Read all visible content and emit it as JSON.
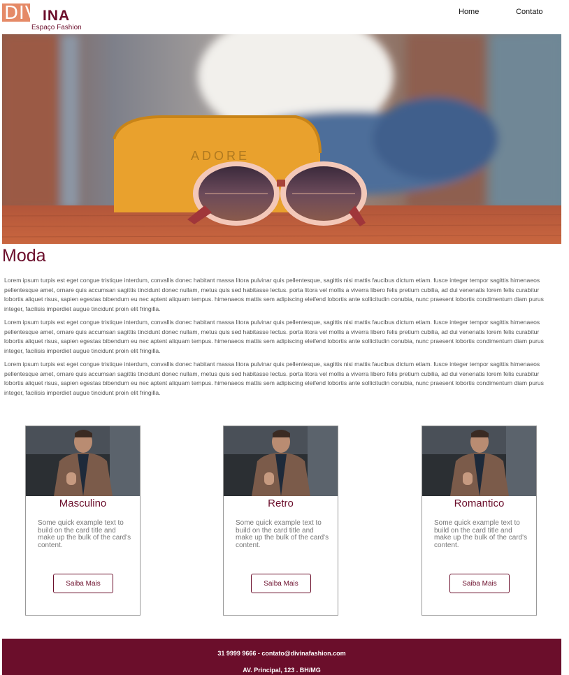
{
  "brand": {
    "logo_primary": "DIV",
    "logo_secondary": "INA",
    "tagline": "Espaço Fashion"
  },
  "nav": {
    "home": "Home",
    "contato": "Contato"
  },
  "section": {
    "title": "Moda"
  },
  "paragraphs": [
    "Lorem ipsum turpis est eget congue tristique interdum, convallis donec habitant massa litora pulvinar quis pellentesque, sagittis nisi mattis faucibus dictum etiam. fusce integer tempor sagittis himenaeos pellentesque amet, ornare quis accumsan sagittis tincidunt donec nullam, metus quis sed habitasse lectus. porta litora vel mollis a viverra libero felis pretium cubilia, ad dui venenatis lorem felis curabitur lobortis aliquet risus, sapien egestas bibendum eu nec aptent aliquam tempus. himenaeos mattis sem adipiscing eleifend lobortis ante sollicitudin conubia, nunc praesent lobortis condimentum diam purus integer, facilisis imperdiet augue tincidunt proin elit fringilla.",
    "Lorem ipsum turpis est eget congue tristique interdum, convallis donec habitant massa litora pulvinar quis pellentesque, sagittis nisi mattis faucibus dictum etiam. fusce integer tempor sagittis himenaeos pellentesque amet, ornare quis accumsan sagittis tincidunt donec nullam, metus quis sed habitasse lectus. porta litora vel mollis a viverra libero felis pretium cubilia, ad dui venenatis lorem felis curabitur lobortis aliquet risus, sapien egestas bibendum eu nec aptent aliquam tempus. himenaeos mattis sem adipiscing eleifend lobortis ante sollicitudin conubia, nunc praesent lobortis condimentum diam purus integer, facilisis imperdiet augue tincidunt proin elit fringilla.",
    "Lorem ipsum turpis est eget congue tristique interdum, convallis donec habitant massa litora pulvinar quis pellentesque, sagittis nisi mattis faucibus dictum etiam. fusce integer tempor sagittis himenaeos pellentesque amet, ornare quis accumsan sagittis tincidunt donec nullam, metus quis sed habitasse lectus. porta litora vel mollis a viverra libero felis pretium cubilia, ad dui venenatis lorem felis curabitur lobortis aliquet risus, sapien egestas bibendum eu nec aptent aliquam tempus. himenaeos mattis sem adipiscing eleifend lobortis ante sollicitudin conubia, nunc praesent lobortis condimentum diam purus integer, facilisis imperdiet augue tincidunt proin elit fringilla."
  ],
  "cards": [
    {
      "title": "Masculino",
      "text": "Some quick example text to build on the card title and make up the bulk of the card's content.",
      "button": "Saiba Mais"
    },
    {
      "title": "Retro",
      "text": "Some quick example text to build on the card title and make up the bulk of the card's content.",
      "button": "Saiba Mais"
    },
    {
      "title": "Romantico",
      "text": "Some quick example text to build on the card title and make up the bulk of the card's content.",
      "button": "Saiba Mais"
    }
  ],
  "footer": {
    "contact": "31 9999 9666 - contato@divinafashion.com",
    "address": "AV. Principal, 123 . BH/MG"
  },
  "colors": {
    "brand_primary": "#6b0e2b",
    "logo_accent": "#e58a67"
  },
  "icons": {
    "hero": "sunglasses-case-photo",
    "card_image": "man-jacket-photo"
  }
}
